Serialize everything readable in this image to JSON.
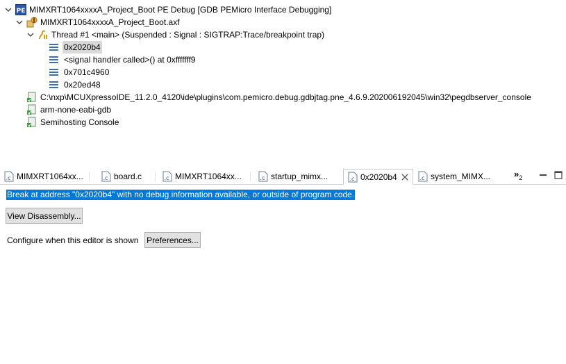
{
  "debug_tree": {
    "launch": {
      "label": "MIMXRT1064xxxxA_Project_Boot PE Debug [GDB PEMicro Interface Debugging]",
      "icon": "pe-launch-icon"
    },
    "executable": {
      "label": "MIMXRT1064xxxxA_Project_Boot.axf",
      "icon": "debug-target-icon"
    },
    "thread": {
      "label": "Thread #1 <main> (Suspended : Signal : SIGTRAP:Trace/breakpoint trap)",
      "icon": "thread-suspended-icon"
    },
    "frames": [
      {
        "label": "0x2020b4",
        "selected": true
      },
      {
        "label": "<signal handler called>() at 0xfffffff9",
        "selected": false
      },
      {
        "label": "0x701c4960",
        "selected": false
      },
      {
        "label": "0x20ed48",
        "selected": false
      }
    ],
    "processes": [
      {
        "label": "C:\\nxp\\MCUXpressoIDE_11.2.0_4120\\ide\\plugins\\com.pemicro.debug.gdbjtag.pne_4.6.9.202006192045\\win32\\pegdbserver_console"
      },
      {
        "label": "arm-none-eabi-gdb"
      },
      {
        "label": "Semihosting Console"
      }
    ]
  },
  "editor_tabs": {
    "tabs": [
      {
        "label": "MIMXRT1064xx...",
        "active": false
      },
      {
        "label": "board.c",
        "active": false
      },
      {
        "label": "MIMXRT1064xx...",
        "active": false
      },
      {
        "label": "startup_mimx...",
        "active": false
      },
      {
        "label": "0x2020b4",
        "active": true
      },
      {
        "label": "system_MIMX...",
        "active": false
      }
    ],
    "overflow_label": "»",
    "overflow_count": "2"
  },
  "editor": {
    "message": "Break at address \"0x2020b4\" with no debug information available, or outside of program code.",
    "view_disassembly_label": "View Disassembly...",
    "configure_text": "Configure when this editor is shown",
    "preferences_label": "Preferences..."
  },
  "colors": {
    "selection_blue": "#0078d7",
    "frame_icon_blue": "#3c6eb4",
    "process_green": "#3c9c3c"
  }
}
